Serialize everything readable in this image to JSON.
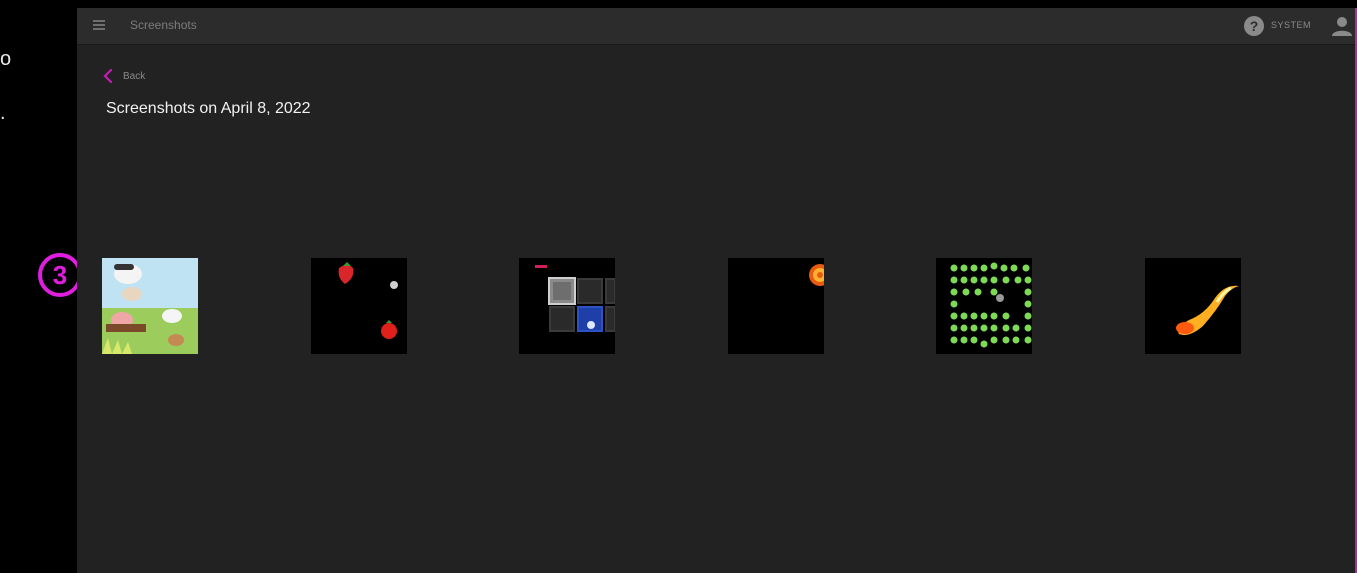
{
  "header": {
    "title": "Screenshots",
    "user_label": "SYSTEM"
  },
  "nav": {
    "back_label": "Back"
  },
  "page": {
    "title": "Screenshots on April 8, 2022"
  },
  "annotation": {
    "step_number": "3"
  },
  "left_fragments": [
    "o",
    "."
  ],
  "thumbnails": [
    {
      "game": "farm-animals",
      "icon": "farm-scene-thumbnail"
    },
    {
      "game": "fruits",
      "icon": "strawberry-tomato-thumbnail"
    },
    {
      "game": "tiles",
      "icon": "grid-tiles-thumbnail"
    },
    {
      "game": "target",
      "icon": "orange-target-thumbnail"
    },
    {
      "game": "bubbles",
      "icon": "green-dots-thumbnail"
    },
    {
      "game": "comet",
      "icon": "flame-trail-thumbnail"
    }
  ],
  "colors": {
    "accent": "#c21db4",
    "background": "#222222",
    "topbar": "#2c2c2c",
    "annotation": "#e01ee0"
  }
}
